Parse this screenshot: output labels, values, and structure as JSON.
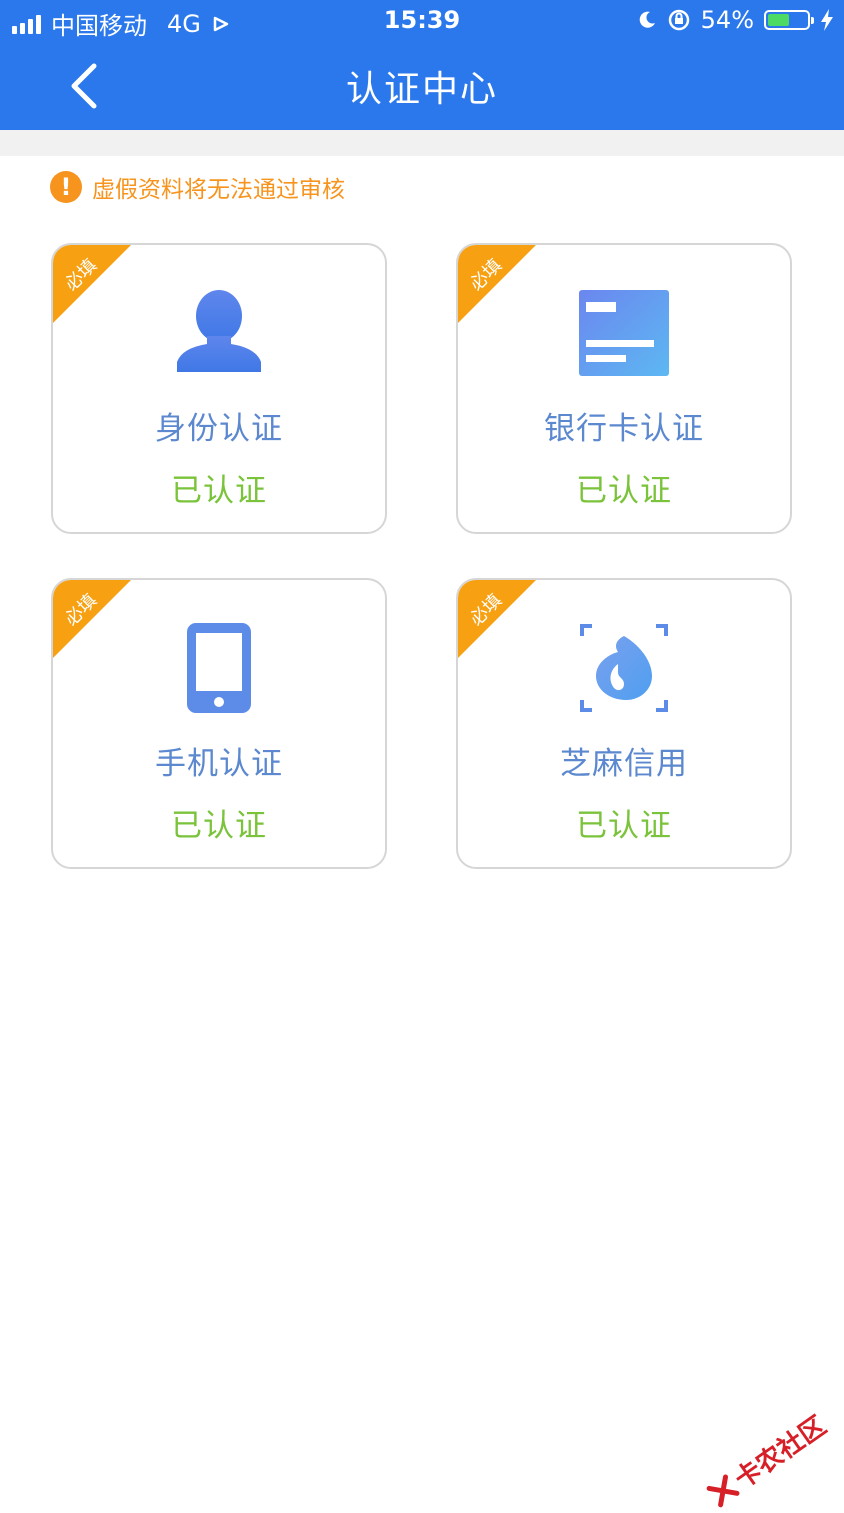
{
  "status_bar": {
    "carrier": "中国移动",
    "network": "4G",
    "time": "15:39",
    "battery_percent": "54%",
    "battery_level": 0.54
  },
  "nav": {
    "title": "认证中心",
    "back_icon": "chevron-left-icon"
  },
  "notice": {
    "icon": "exclamation-icon",
    "text": "虚假资料将无法通过审核"
  },
  "cards": [
    {
      "badge": "必填",
      "name": "身份认证",
      "status": "已认证",
      "icon": "person-icon"
    },
    {
      "badge": "必填",
      "name": "银行卡认证",
      "status": "已认证",
      "icon": "bank-card-icon"
    },
    {
      "badge": "必填",
      "name": "手机认证",
      "status": "已认证",
      "icon": "phone-icon"
    },
    {
      "badge": "必填",
      "name": "芝麻信用",
      "status": "已认证",
      "icon": "sesame-credit-icon"
    }
  ],
  "watermark": {
    "text": "卡农社区"
  },
  "colors": {
    "header": "#2a78ec",
    "warning": "#f7941d",
    "badge": "#f7a012",
    "card_name": "#5b88cf",
    "verified": "#7ac33a"
  }
}
